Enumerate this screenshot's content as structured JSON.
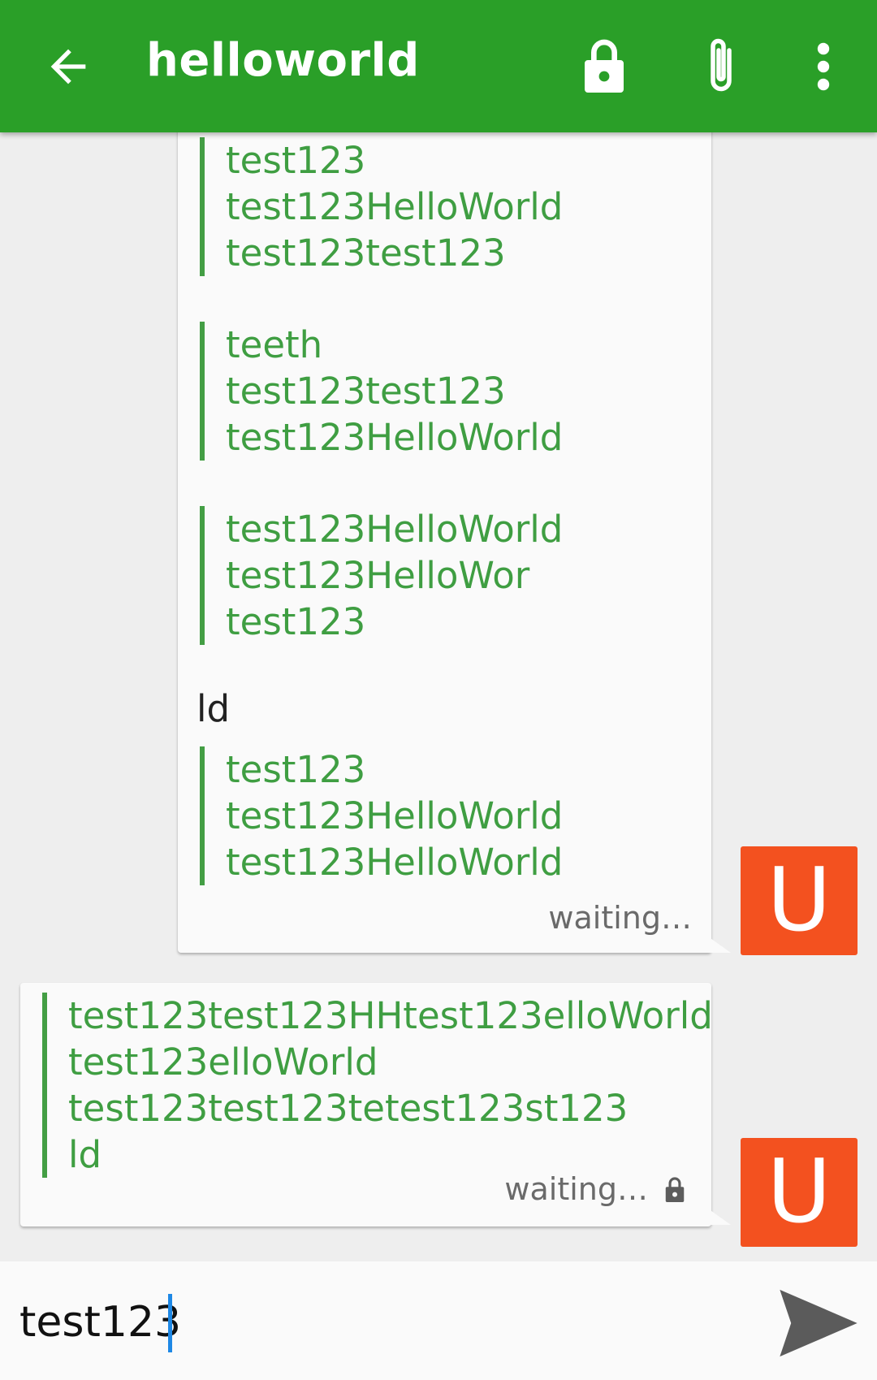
{
  "appbar": {
    "title": "helloworld",
    "icons": [
      "back-arrow-icon",
      "lock-icon",
      "paperclip-icon",
      "more-vert-icon"
    ],
    "color": "#2a9f28"
  },
  "messages": [
    {
      "side": "right",
      "blocks": [
        {
          "type": "quote",
          "lines": [
            "test123",
            "test123HelloWorld",
            "test123test123"
          ]
        },
        {
          "type": "quote",
          "lines": [
            "teeth",
            "test123test123",
            "test123HelloWorld"
          ]
        },
        {
          "type": "quote",
          "lines": [
            "test123HelloWorld",
            "test123HelloWor",
            "test123"
          ]
        },
        {
          "type": "text",
          "text": "ld"
        },
        {
          "type": "quote",
          "lines": [
            "test123",
            "test123HelloWorld",
            "test123HelloWorld"
          ]
        }
      ],
      "status": "waiting…",
      "avatar": "U"
    },
    {
      "side": "right",
      "blocks": [
        {
          "type": "quote",
          "lines": [
            "test123test123HHtest123elloWorld",
            "test123elloWorld",
            "test123test123tetest123st123",
            "ld"
          ]
        }
      ],
      "status": "waiting…",
      "avatar": "U"
    }
  ],
  "input": {
    "value": "test123"
  },
  "colors": {
    "quote_bar": "#439e44",
    "quote_text": "#3f9e42",
    "avatar": "#f3511f",
    "caret": "#1e88e5"
  }
}
